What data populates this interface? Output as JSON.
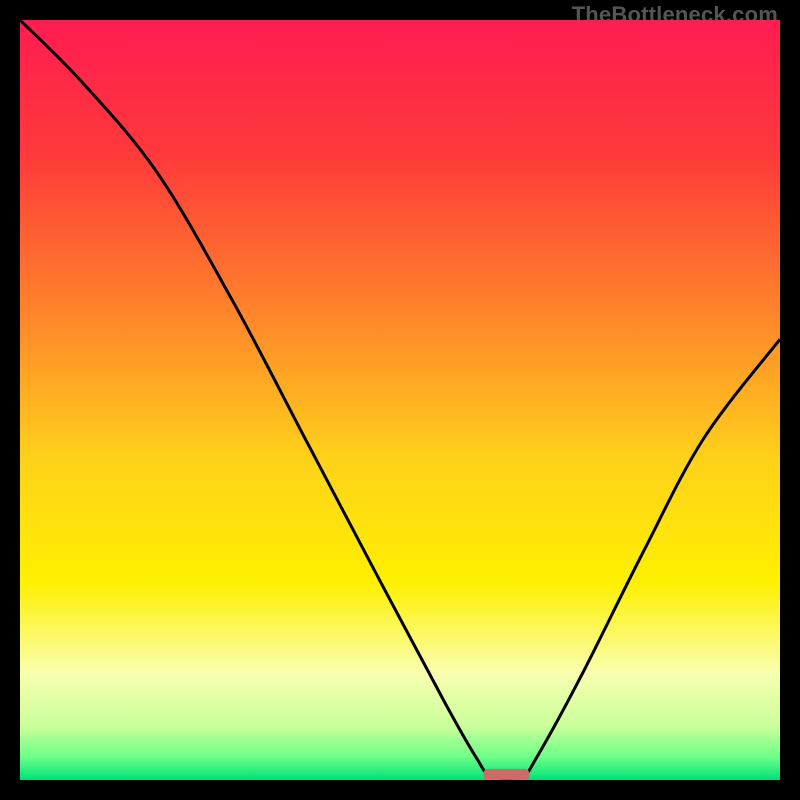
{
  "watermark": "TheBottleneck.com",
  "chart_data": {
    "type": "line",
    "title": "",
    "xlabel": "",
    "ylabel": "",
    "xlim": [
      0,
      100
    ],
    "ylim": [
      0,
      100
    ],
    "gradient_stops": [
      {
        "offset": 0.0,
        "color": "#ff1c52"
      },
      {
        "offset": 0.18,
        "color": "#ff3a3a"
      },
      {
        "offset": 0.4,
        "color": "#ff8a2a"
      },
      {
        "offset": 0.58,
        "color": "#ffd21a"
      },
      {
        "offset": 0.74,
        "color": "#fff000"
      },
      {
        "offset": 0.86,
        "color": "#f9ffb0"
      },
      {
        "offset": 0.93,
        "color": "#c8ff9a"
      },
      {
        "offset": 0.97,
        "color": "#6bff87"
      },
      {
        "offset": 1.0,
        "color": "#00e07a"
      }
    ],
    "series": [
      {
        "name": "bottleneck-curve",
        "points": [
          {
            "x": 0,
            "y": 100
          },
          {
            "x": 8,
            "y": 92
          },
          {
            "x": 18,
            "y": 80
          },
          {
            "x": 28,
            "y": 63
          },
          {
            "x": 38,
            "y": 44
          },
          {
            "x": 48,
            "y": 25
          },
          {
            "x": 56,
            "y": 10
          },
          {
            "x": 60,
            "y": 3
          },
          {
            "x": 62,
            "y": 0.5
          },
          {
            "x": 66,
            "y": 0.5
          },
          {
            "x": 68,
            "y": 3
          },
          {
            "x": 74,
            "y": 14
          },
          {
            "x": 82,
            "y": 30
          },
          {
            "x": 90,
            "y": 45
          },
          {
            "x": 100,
            "y": 58
          }
        ]
      }
    ],
    "marker": {
      "x_center": 64,
      "width": 6,
      "y": 0.8,
      "color": "#d06a6a"
    }
  }
}
